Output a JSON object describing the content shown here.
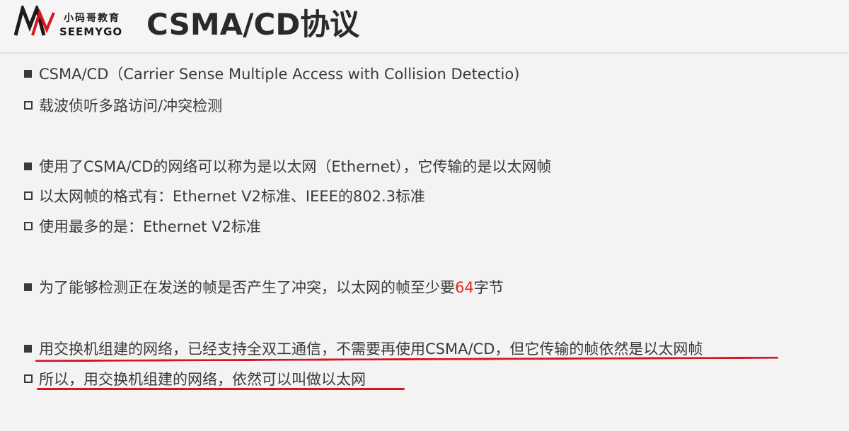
{
  "header": {
    "logo_cn": "小码哥教育",
    "logo_en": "SEEMYGO",
    "title": "CSMA/CD协议"
  },
  "lines": [
    {
      "text": "CSMA/CD（Carrier Sense Multiple Access with Collision Detectio)"
    },
    {
      "text": "载波侦听多路访问/冲突检测"
    },
    {
      "text": "使用了CSMA/CD的网络可以称为是以太网（Ethernet），它传输的是以太网帧"
    },
    {
      "text": "以太网帧的格式有：Ethernet V2标准、IEEE的802.3标准"
    },
    {
      "text": "使用最多的是：Ethernet V2标准"
    },
    {
      "pre": "为了能够检测正在发送的帧是否产生了冲突，以太网的帧至少要",
      "highlight": "64",
      "post": "字节"
    },
    {
      "text": "用交换机组建的网络，已经支持全双工通信，不需要再使用CSMA/CD，但它传输的帧依然是以太网帧"
    },
    {
      "text": "所以，用交换机组建的网络，依然可以叫做以太网"
    }
  ],
  "colors": {
    "highlight": "#e02a1c",
    "annotation": "#d8141f",
    "logo_red": "#d8141f"
  }
}
